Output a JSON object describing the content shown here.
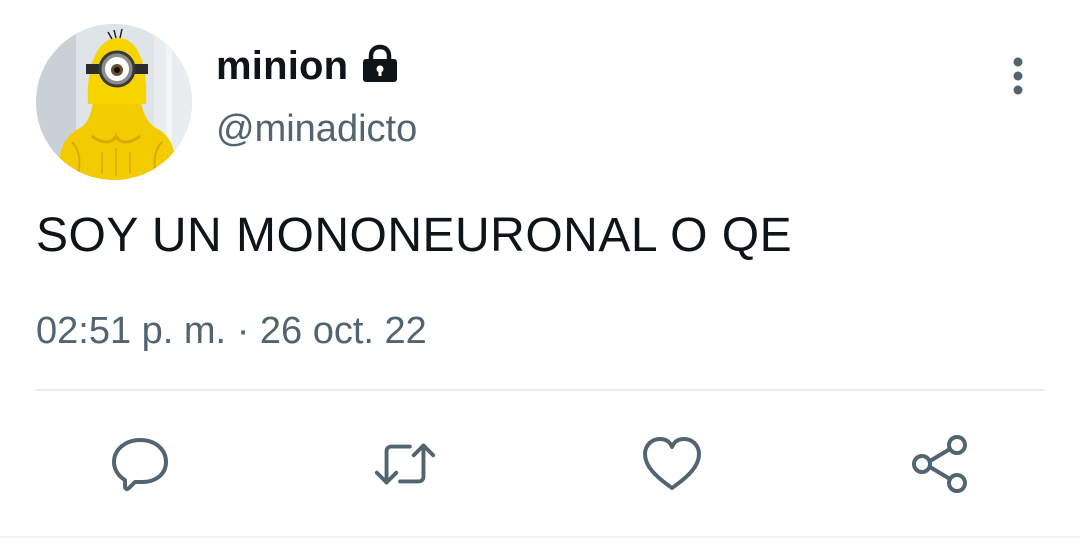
{
  "author": {
    "display_name": "minion",
    "handle": "@minadicto",
    "protected": true,
    "avatar": "minion-avatar"
  },
  "tweet": {
    "text": "SOY UN MONONEURONAL O QE",
    "time": "02:51 p. m.",
    "separator": "·",
    "date": "26 oct. 22"
  },
  "actions": {
    "reply": "reply-icon",
    "retweet": "retweet-icon",
    "like": "heart-icon",
    "share": "share-icon",
    "more": "more-vertical-icon"
  },
  "colors": {
    "primary_text": "#0f1419",
    "secondary_text": "#536471",
    "divider": "#e6ecf0",
    "avatar_yellow": "#f5d100"
  }
}
